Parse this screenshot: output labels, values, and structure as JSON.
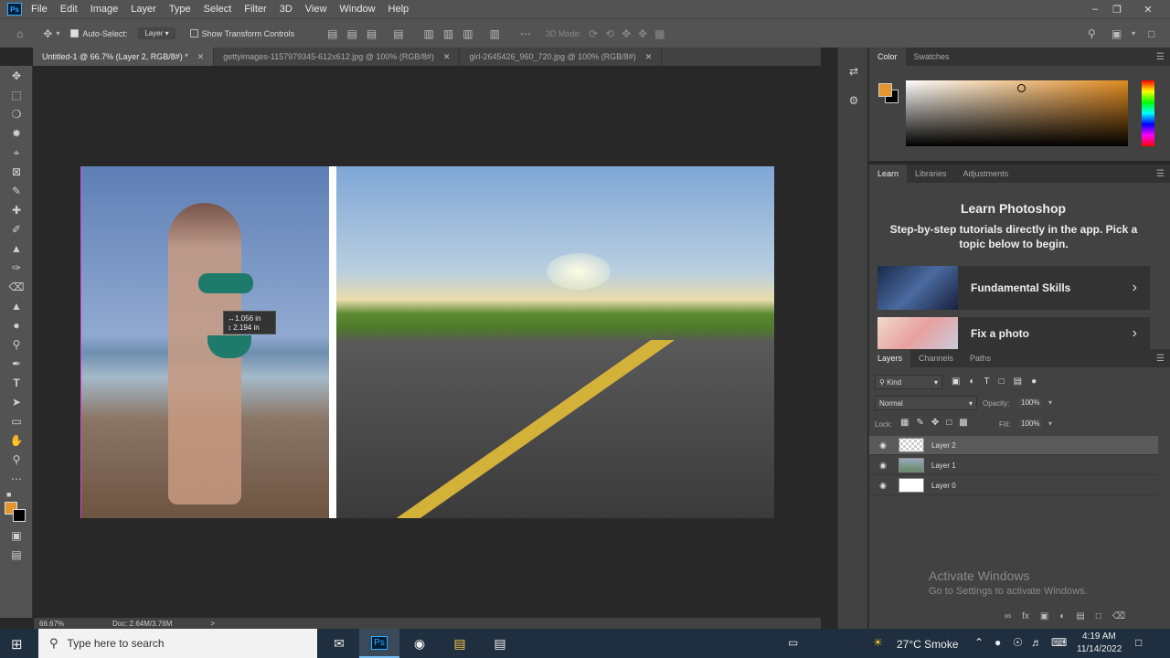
{
  "app": {
    "logo": "Ps",
    "menus": [
      "File",
      "Edit",
      "Image",
      "Layer",
      "Type",
      "Select",
      "Filter",
      "3D",
      "View",
      "Window",
      "Help"
    ],
    "window_controls": [
      "minimize-icon",
      "restore-icon",
      "close-icon"
    ]
  },
  "options_bar": {
    "auto_select_label": "Auto-Select:",
    "auto_select_checked": true,
    "target": "Layer",
    "show_transform_label": "Show Transform Controls",
    "show_transform_checked": false,
    "mode_3d_label": "3D Mode:"
  },
  "tabs": [
    {
      "label": "Untitled-1 @ 66.7% (Layer 2, RGB/8#) *",
      "active": true
    },
    {
      "label": "gettyimages-1157979345-612x612.jpg @ 100% (RGB/8#)",
      "active": false
    },
    {
      "label": "girl-2645426_960_720.jpg @ 100% (RGB/8#)",
      "active": false
    }
  ],
  "canvas": {
    "measure_w": "↔1.056 in",
    "measure_h": "↕ 2.194 in"
  },
  "status": {
    "zoom": "66.67%",
    "doc": "Doc: 2.64M/3.76M",
    "arrow": ">"
  },
  "color_panel": {
    "tabs": [
      "Color",
      "Swatches"
    ],
    "foreground": "#e3962e",
    "background": "#000000"
  },
  "learn_panel": {
    "tabs": [
      "Learn",
      "Libraries",
      "Adjustments"
    ],
    "title": "Learn Photoshop",
    "description": "Step-by-step tutorials directly in the app. Pick a topic below to begin.",
    "cards": [
      {
        "label": "Fundamental Skills"
      },
      {
        "label": "Fix a photo"
      }
    ]
  },
  "layers_panel": {
    "tabs": [
      "Layers",
      "Channels",
      "Paths"
    ],
    "filter_kind": "Kind",
    "blend_mode": "Normal",
    "opacity_label": "Opacity:",
    "opacity_value": "100%",
    "lock_label": "Lock:",
    "fill_label": "Fill:",
    "fill_value": "100%",
    "layers": [
      {
        "name": "Layer 2",
        "selected": true
      },
      {
        "name": "Layer 1",
        "selected": false
      },
      {
        "name": "Layer 0",
        "selected": false
      }
    ]
  },
  "watermark": {
    "line1": "Activate Windows",
    "line2": "Go to Settings to activate Windows."
  },
  "taskbar": {
    "search_placeholder": "Type here to search",
    "weather": "27°C Smoke",
    "time": "4:19 AM",
    "date": "11/14/2022"
  }
}
